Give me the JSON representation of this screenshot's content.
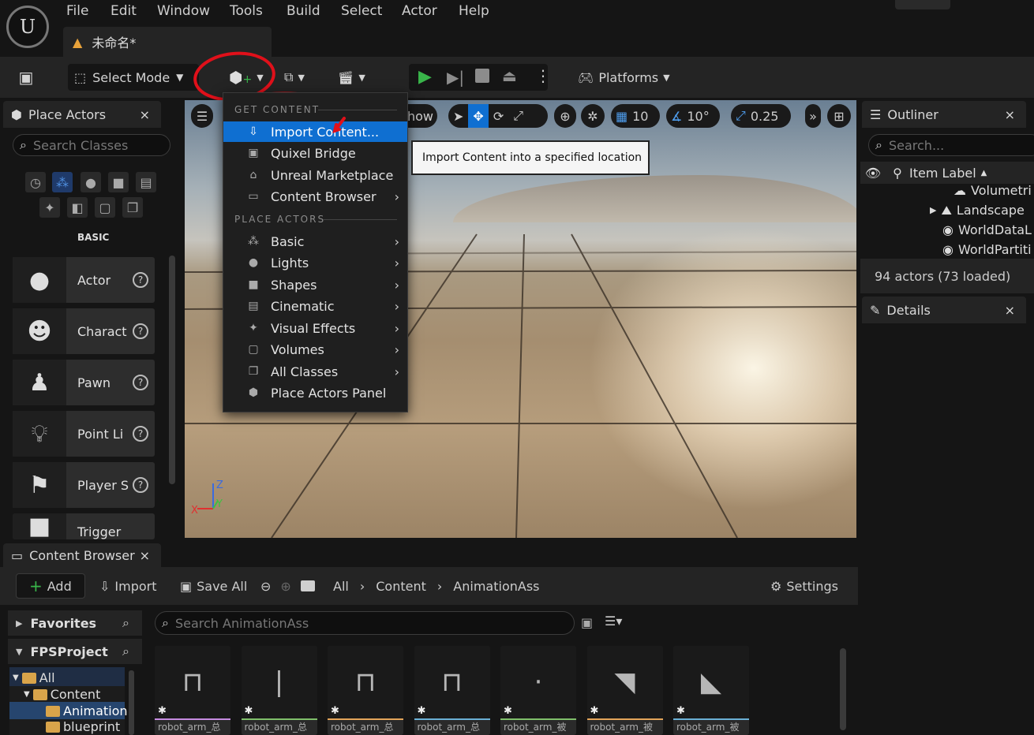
{
  "menu": {
    "items": [
      "File",
      "Edit",
      "Window",
      "Tools",
      "Build",
      "Select",
      "Actor",
      "Help"
    ],
    "doc_tab": "未命名*"
  },
  "toolbar": {
    "select_mode": "Select Mode",
    "platforms": "Platforms"
  },
  "place_actors": {
    "tab": "Place Actors",
    "search_placeholder": "Search Classes",
    "category": "BASIC",
    "actors": [
      "Actor",
      "Charact",
      "Pawn",
      "Point Li",
      "Player S",
      "Trigger"
    ]
  },
  "viewport": {
    "show_label": "how",
    "grid_snap": "10",
    "rot_snap": "10°",
    "scale_snap": "0.25"
  },
  "get_content_menu": {
    "header_get": "GET CONTENT",
    "header_place": "PLACE ACTORS",
    "get_items": [
      "Import Content...",
      "Quixel Bridge",
      "Unreal Marketplace",
      "Content Browser"
    ],
    "place_items": [
      "Basic",
      "Lights",
      "Shapes",
      "Cinematic",
      "Visual Effects",
      "Volumes",
      "All Classes",
      "Place Actors Panel"
    ],
    "tooltip": "Import Content into a specified location"
  },
  "outliner": {
    "tab": "Outliner",
    "search_placeholder": "Search...",
    "column": "Item Label",
    "rows": [
      "Volumetri",
      "Landscape",
      "WorldDataL",
      "WorldPartiti"
    ],
    "summary": "94 actors (73 loaded)"
  },
  "details": {
    "tab": "Details"
  },
  "content_browser": {
    "tab": "Content Browser",
    "add": "Add",
    "import": "Import",
    "save_all": "Save All",
    "path": [
      "All",
      "Content",
      "AnimationAss"
    ],
    "settings": "Settings",
    "search_placeholder": "Search AnimationAss",
    "favorites": "Favorites",
    "project": "FPSProject",
    "tree": [
      "All",
      "Content",
      "Animation",
      "blueprint"
    ],
    "assets": [
      "robot_arm_总",
      "robot_arm_总",
      "robot_arm_总",
      "robot_arm_总",
      "robot_arm_被",
      "robot_arm_被",
      "robot_arm_被"
    ],
    "asset_colors": [
      "#c58be0",
      "#7fbf6a",
      "#e3a45a",
      "#6ab0d6",
      "#7fbf6a",
      "#e3a45a",
      "#6ab0d6"
    ]
  },
  "colors": {
    "accent": "#0f6fd1",
    "play": "#39b54a",
    "annotation": "#e0101a"
  }
}
